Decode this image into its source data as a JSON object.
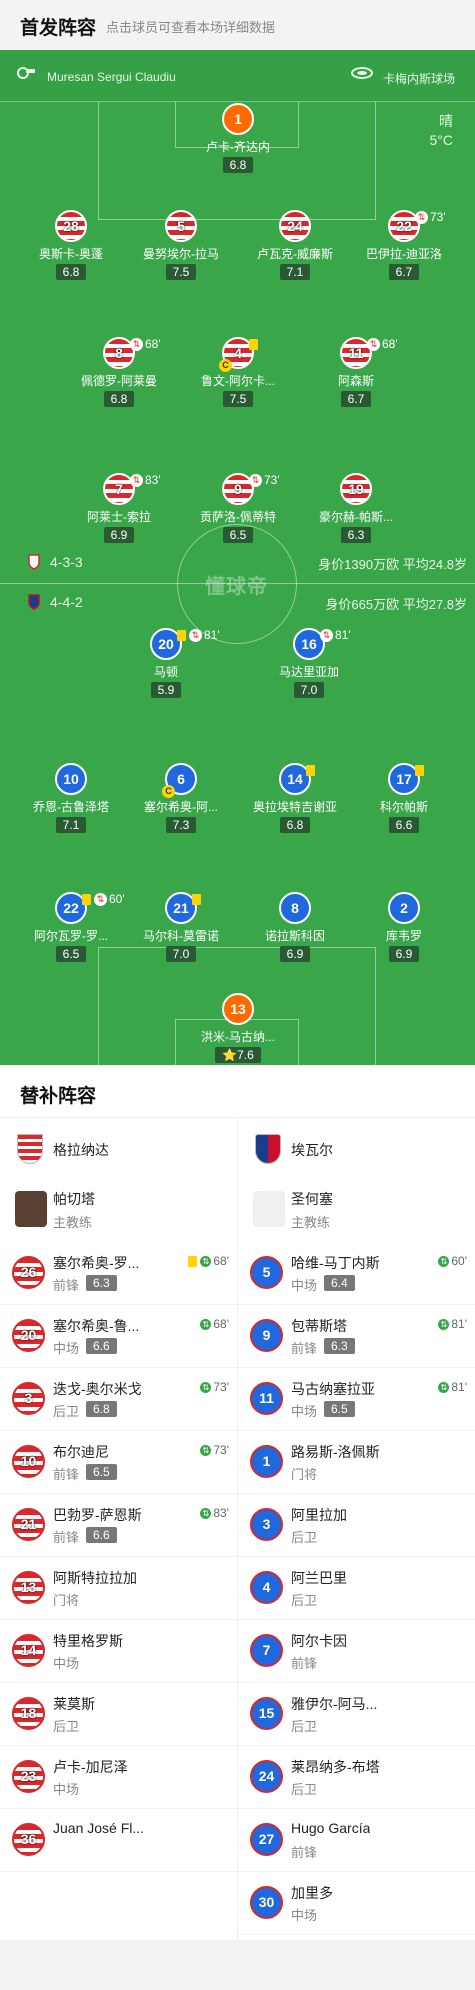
{
  "header": {
    "title": "首发阵容",
    "subtitle": "点击球员可查看本场详细数据"
  },
  "match": {
    "referee": "Muresan Sergui Claudiu",
    "stadium": "卡梅内斯球场",
    "weather": "晴",
    "temperature": "5°C",
    "watermark": "懂球帝"
  },
  "home": {
    "formation": "4-3-3",
    "value_text": "身价1390万欧 平均24.8岁",
    "players": [
      {
        "num": "1",
        "name": "卢卡-齐达内",
        "rating": "6.8",
        "role": "gk"
      },
      {
        "num": "28",
        "name": "奥斯卡-奥蓬",
        "rating": "6.8"
      },
      {
        "num": "5",
        "name": "曼努埃尔-拉马",
        "rating": "7.5"
      },
      {
        "num": "24",
        "name": "卢瓦克-威廉斯",
        "rating": "7.1"
      },
      {
        "num": "22",
        "name": "巴伊拉-迪亚洛",
        "rating": "6.7",
        "sub_min": "73'"
      },
      {
        "num": "8",
        "name": "佩德罗-阿莱曼",
        "rating": "6.8",
        "sub_min": "68'"
      },
      {
        "num": "4",
        "name": "鲁文-阿尔卡...",
        "rating": "7.5",
        "yellow": true,
        "captain": "C"
      },
      {
        "num": "11",
        "name": "阿森斯",
        "rating": "6.7",
        "sub_min": "68'"
      },
      {
        "num": "7",
        "name": "阿莱士-索拉",
        "rating": "6.9",
        "sub_min": "83'"
      },
      {
        "num": "9",
        "name": "贡萨洛-佩蒂特",
        "rating": "6.5",
        "sub_min": "73'"
      },
      {
        "num": "19",
        "name": "豪尔赫-帕斯...",
        "rating": "6.3"
      }
    ]
  },
  "away": {
    "formation": "4-4-2",
    "value_text": "身价665万欧  平均27.8岁",
    "players": [
      {
        "num": "20",
        "name": "马顿",
        "rating": "5.9",
        "yellow": true,
        "sub_min": "81'"
      },
      {
        "num": "16",
        "name": "马达里亚加",
        "rating": "7.0",
        "sub_min": "81'"
      },
      {
        "num": "10",
        "name": "乔恩-古鲁泽塔",
        "rating": "7.1"
      },
      {
        "num": "6",
        "name": "塞尔希奥-阿...",
        "rating": "7.3",
        "captain": "C"
      },
      {
        "num": "14",
        "name": "奥拉埃特吉谢亚",
        "rating": "6.8",
        "yellow": true
      },
      {
        "num": "17",
        "name": "科尔帕斯",
        "rating": "6.6",
        "yellow": true
      },
      {
        "num": "22",
        "name": "阿尔瓦罗-罗...",
        "rating": "6.5",
        "yellow": true,
        "sub_min": "60'"
      },
      {
        "num": "21",
        "name": "马尔科-莫雷诺",
        "rating": "7.0",
        "yellow": true
      },
      {
        "num": "8",
        "name": "诺拉斯科因",
        "rating": "6.9"
      },
      {
        "num": "2",
        "name": "库韦罗",
        "rating": "6.9"
      },
      {
        "num": "13",
        "name": "洪米-马古纳...",
        "rating": "7.6",
        "role": "gk",
        "best": "⭐"
      }
    ]
  },
  "subs": {
    "title": "替补阵容",
    "home_team": "格拉纳达",
    "away_team": "埃瓦尔",
    "home_coach": {
      "name": "帕切塔",
      "role": "主教练"
    },
    "away_coach": {
      "name": "圣何塞",
      "role": "主教练"
    },
    "home_list": [
      {
        "num": "26",
        "name": "塞尔希奥-罗...",
        "pos": "前锋",
        "rating": "6.3",
        "yellow": true,
        "min": "68'"
      },
      {
        "num": "20",
        "name": "塞尔希奥-鲁...",
        "pos": "中场",
        "rating": "6.6",
        "min": "68'"
      },
      {
        "num": "3",
        "name": "迭戈-奥尔米戈",
        "pos": "后卫",
        "rating": "6.8",
        "min": "73'"
      },
      {
        "num": "10",
        "name": "布尔迪尼",
        "pos": "前锋",
        "rating": "6.5",
        "min": "73'"
      },
      {
        "num": "21",
        "name": "巴勃罗-萨恩斯",
        "pos": "前锋",
        "rating": "6.6",
        "min": "83'"
      },
      {
        "num": "13",
        "name": "阿斯特拉拉加",
        "pos": "门将"
      },
      {
        "num": "14",
        "name": "特里格罗斯",
        "pos": "中场"
      },
      {
        "num": "18",
        "name": "莱莫斯",
        "pos": "后卫"
      },
      {
        "num": "23",
        "name": "卢卡-加尼泽",
        "pos": "中场"
      },
      {
        "num": "36",
        "name": "Juan José Fl...",
        "pos": ""
      }
    ],
    "away_list": [
      {
        "num": "5",
        "name": "哈维-马丁内斯",
        "pos": "中场",
        "rating": "6.4",
        "min": "60'"
      },
      {
        "num": "9",
        "name": "包蒂斯塔",
        "pos": "前锋",
        "rating": "6.3",
        "min": "81'"
      },
      {
        "num": "11",
        "name": "马古纳塞拉亚",
        "pos": "中场",
        "rating": "6.5",
        "min": "81'"
      },
      {
        "num": "1",
        "name": "路易斯-洛佩斯",
        "pos": "门将"
      },
      {
        "num": "3",
        "name": "阿里拉加",
        "pos": "后卫"
      },
      {
        "num": "4",
        "name": "阿兰巴里",
        "pos": "后卫"
      },
      {
        "num": "7",
        "name": "阿尔卡因",
        "pos": "前锋"
      },
      {
        "num": "15",
        "name": "雅伊尔-阿马...",
        "pos": "后卫"
      },
      {
        "num": "24",
        "name": "莱昂纳多-布塔",
        "pos": "后卫"
      },
      {
        "num": "27",
        "name": "Hugo García",
        "pos": "前锋"
      },
      {
        "num": "30",
        "name": "加里多",
        "pos": "中场"
      }
    ]
  }
}
